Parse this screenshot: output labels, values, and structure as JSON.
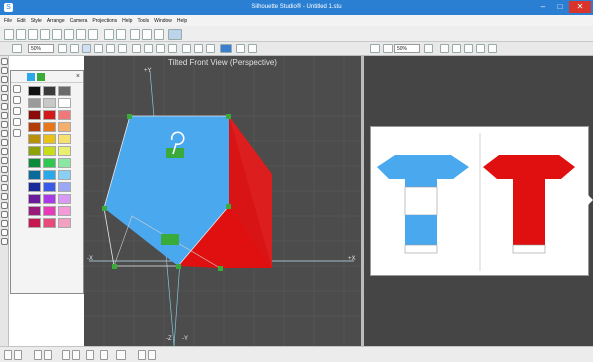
{
  "titlebar": {
    "title": "Silhouette Studio® - Untitled 1.stu",
    "minimize_label": "–",
    "maximize_label": "□",
    "close_label": "✕"
  },
  "menu": [
    "File",
    "Edit",
    "Style",
    "Arrange",
    "Camera",
    "Projections",
    "Help",
    "Tools",
    "Window",
    "Help"
  ],
  "view3d": {
    "title": "Tilted Front View (Perspective)",
    "axes": {
      "pos_y": "+Y",
      "neg_x": "-X",
      "pos_x": "+X",
      "neg_z": "-Z",
      "neg_y": "-Y"
    }
  },
  "zoom": {
    "left": "50%",
    "right": "50%"
  },
  "colors": {
    "blue_face": "#4aa8ef",
    "red_face": "#e01010",
    "green_handle": "#3aaa3a",
    "background_3d": "#4c4c4c",
    "palette": [
      [
        "#111111",
        "#3a3a3a",
        "#6a6a6a"
      ],
      [
        "#9a9a9a",
        "#c8c8c8",
        "#ffffff"
      ],
      [
        "#8b0a0a",
        "#d21a1a",
        "#f07878"
      ],
      [
        "#b33c08",
        "#e8761a",
        "#f5b070"
      ],
      [
        "#b8900a",
        "#e8c21a",
        "#f5e070"
      ],
      [
        "#8ea00a",
        "#c8dc1a",
        "#e8f070"
      ],
      [
        "#0a8a3a",
        "#2ec850",
        "#8ae8a0"
      ],
      [
        "#0a6a9a",
        "#2aa8e8",
        "#8ad0f5"
      ],
      [
        "#1a2a9a",
        "#3a5ae8",
        "#9aa8f5"
      ],
      [
        "#6a1a9a",
        "#a83ae8",
        "#d89af5"
      ],
      [
        "#9a1a7a",
        "#e83ab8",
        "#f59ad8"
      ],
      [
        "#c81850",
        "#e84a7a",
        "#f5a0c0"
      ]
    ]
  }
}
